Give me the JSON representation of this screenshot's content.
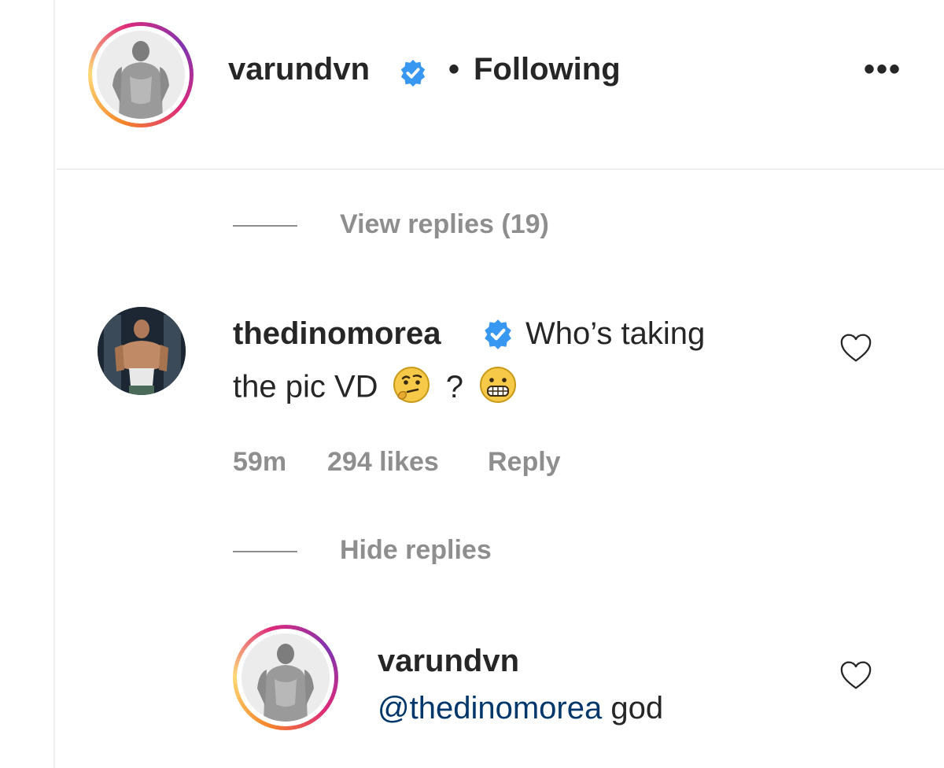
{
  "post_header": {
    "username": "varundvn",
    "separator": "•",
    "follow_status": "Following",
    "more_glyph": "•••"
  },
  "thread": {
    "view_replies_label": "View replies (19)",
    "hide_replies_label": "Hide replies"
  },
  "comment": {
    "username": "thedinomorea",
    "text_line1": "Who’s taking",
    "text_line2": "the pic VD",
    "text_question": "?",
    "emoji_1": "thinking-face",
    "emoji_2": "grimacing-face",
    "time": "59m",
    "likes": "294 likes",
    "reply_label": "Reply"
  },
  "reply": {
    "username": "varundvn",
    "mention": "@thedinomorea",
    "text": "god"
  },
  "colors": {
    "verified_blue": "#3897f0",
    "mention_blue": "#00376b",
    "muted_gray": "#8e8e8e",
    "text": "#262626"
  }
}
